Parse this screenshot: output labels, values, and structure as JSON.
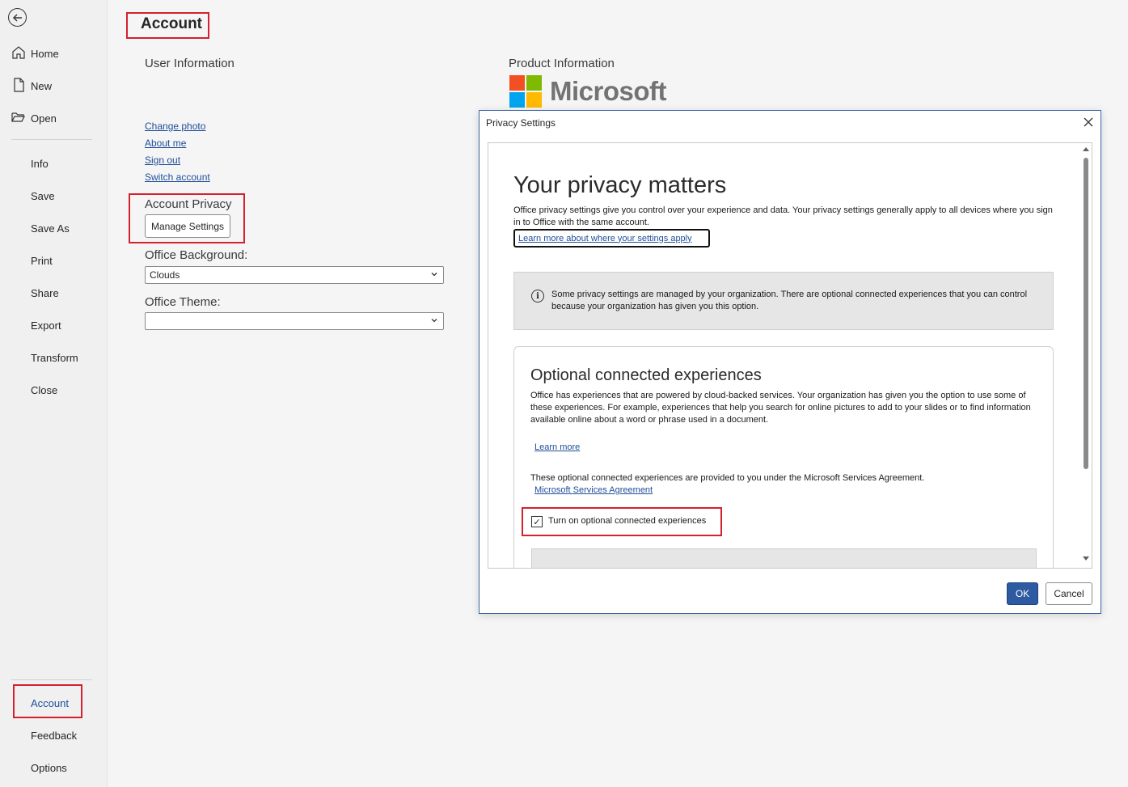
{
  "sidebar": {
    "back_icon": "back-arrow-icon",
    "items": [
      {
        "label": "Home",
        "icon": "home-icon"
      },
      {
        "label": "New",
        "icon": "new-document-icon"
      },
      {
        "label": "Open",
        "icon": "open-folder-icon"
      },
      {
        "label": "Info"
      },
      {
        "label": "Save"
      },
      {
        "label": "Save As"
      },
      {
        "label": "Print"
      },
      {
        "label": "Share"
      },
      {
        "label": "Export"
      },
      {
        "label": "Transform"
      },
      {
        "label": "Close"
      }
    ],
    "bottom_items": [
      {
        "label": "Account",
        "selected": true
      },
      {
        "label": "Feedback"
      },
      {
        "label": "Options"
      }
    ]
  },
  "main": {
    "title": "Account",
    "user_info": {
      "heading": "User Information",
      "links": [
        "Change photo",
        "About me",
        "Sign out",
        "Switch account"
      ]
    },
    "account_privacy": {
      "heading": "Account Privacy",
      "button": "Manage Settings"
    },
    "office_background": {
      "label": "Office Background:",
      "value": "Clouds"
    },
    "office_theme": {
      "label": "Office Theme:",
      "value": ""
    },
    "product_info": {
      "heading": "Product Information",
      "logo_text": "Microsoft",
      "logo_colors": [
        "#f25022",
        "#7fba00",
        "#00a4ef",
        "#ffb900"
      ]
    }
  },
  "dialog": {
    "title": "Privacy Settings",
    "heading": "Your privacy matters",
    "intro": "Office privacy settings give you control over your experience and data. Your privacy settings generally apply to all devices where you sign in to Office with the same account.",
    "learn_where_link": "Learn more about where your settings apply",
    "info_message": "Some privacy settings are managed by your organization. There are optional connected experiences that you can control because your organization has given you this option.",
    "optional": {
      "heading": "Optional connected experiences",
      "description": "Office has experiences that are powered by cloud-backed services. Your organization has given you the option to use some of these experiences. For example, experiences that help you search for online pictures to add to your slides or to find information available online about a word or phrase used in a document.",
      "learn_more": "Learn more",
      "agreement_text": "These optional connected experiences are provided to you under the Microsoft Services Agreement.",
      "agreement_link": "Microsoft Services Agreement",
      "checkbox_label": "Turn on optional connected experiences",
      "checkbox_checked": true,
      "check_mark": "✓"
    },
    "ok_label": "OK",
    "cancel_label": "Cancel"
  }
}
